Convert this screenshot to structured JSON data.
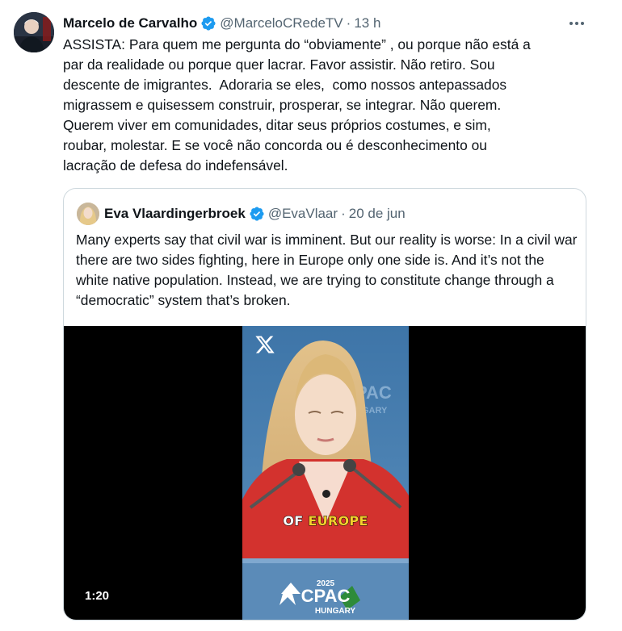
{
  "tweet": {
    "author_name": "Marcelo de Carvalho",
    "author_handle": "@MarceloCRedeTV",
    "separator": "·",
    "time": "13 h",
    "text": "ASSISTA: Para quem me pergunta do “obviamente” , ou porque não está a\npar da realidade ou porque quer lacrar. Favor assistir. Não retiro. Sou\ndescente de imigrantes.  Adoraria se eles,  como nossos antepassados\nmigrassem e quisessem construir, prosperar, se integrar. Não querem.\nQuerem viver em comunidades, ditar seus próprios costumes, e sim,\nroubar, molestar. E se você não concorda ou é desconhecimento ou\nlacração de defesa do indefensável."
  },
  "quoted_tweet": {
    "author_name": "Eva Vlaardingerbroek",
    "author_handle": "@EvaVlaar",
    "separator": "·",
    "date": "20 de jun",
    "text": "Many experts say that civil war is imminent. But our reality is worse: In a civil war there are two sides fighting, here in Europe only one side is. And it’s not the white native population. Instead, we are trying to constitute change through a “democratic” system that’s broken.",
    "video": {
      "caption_word_1": "OF",
      "caption_word_2": "EUROPE",
      "duration": "1:20",
      "podium_year": "2025",
      "podium_brand": "CPAC",
      "podium_location": "HUNGARY"
    }
  },
  "colors": {
    "verified_blue": "#1d9bf0",
    "text_primary": "#0f1419",
    "text_secondary": "#536471",
    "border": "#cfd9de",
    "caption_highlight": "#f4d02e"
  },
  "icons": {
    "verified": "verified-badge-icon",
    "more": "more-options-icon",
    "watermark": "x-logo-icon"
  }
}
